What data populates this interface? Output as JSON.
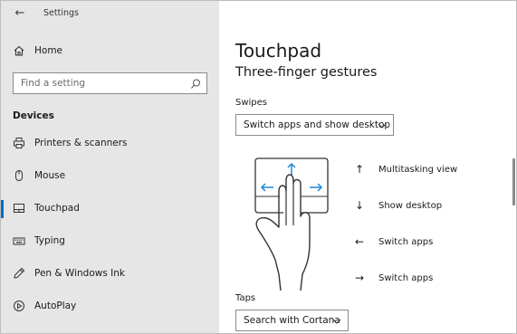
{
  "window": {
    "title": "Settings",
    "back_icon": "back-arrow-icon",
    "controls": {
      "minimize": "—",
      "maximize": "☐",
      "close": "✕"
    }
  },
  "sidebar": {
    "home": {
      "label": "Home",
      "icon": "home-icon"
    },
    "search": {
      "placeholder": "Find a setting",
      "icon": "search-icon"
    },
    "section": "Devices",
    "items": [
      {
        "label": "Printers & scanners",
        "icon": "printer-icon",
        "active": false
      },
      {
        "label": "Mouse",
        "icon": "mouse-icon",
        "active": false
      },
      {
        "label": "Touchpad",
        "icon": "touchpad-icon",
        "active": true
      },
      {
        "label": "Typing",
        "icon": "keyboard-icon",
        "active": false
      },
      {
        "label": "Pen & Windows Ink",
        "icon": "pen-icon",
        "active": false
      },
      {
        "label": "AutoPlay",
        "icon": "autoplay-icon",
        "active": false
      }
    ]
  },
  "main": {
    "title": "Touchpad",
    "subtitle": "Three-finger gestures",
    "swipes": {
      "label": "Swipes",
      "value": "Switch apps and show desktop"
    },
    "gesture_legend": [
      {
        "arrow": "↑",
        "label": "Multitasking view"
      },
      {
        "arrow": "↓",
        "label": "Show desktop"
      },
      {
        "arrow": "←",
        "label": "Switch apps"
      },
      {
        "arrow": "→",
        "label": "Switch apps"
      }
    ],
    "taps": {
      "label": "Taps",
      "value": "Search with Cortana"
    }
  },
  "colors": {
    "accent": "#0a6cc9",
    "sidebar_bg": "#e6e6e6",
    "gesture_arrow": "#1e88d8"
  }
}
